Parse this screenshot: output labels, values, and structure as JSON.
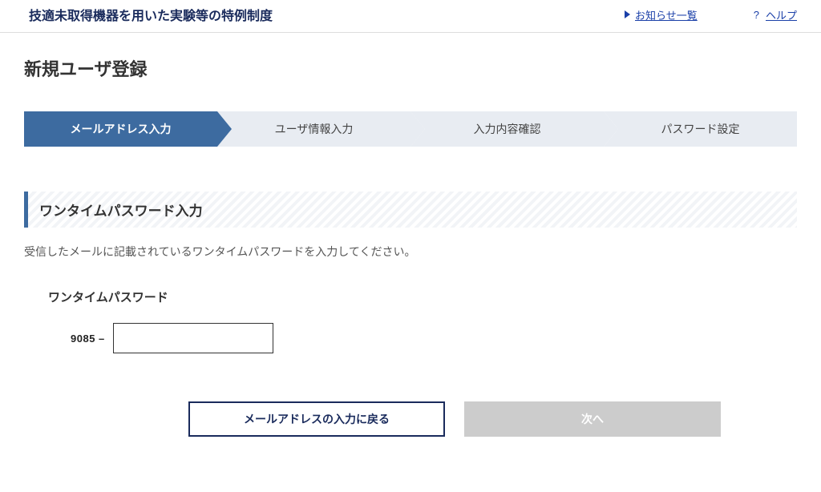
{
  "header": {
    "app_title": "技適未取得機器を用いた実験等の特例制度",
    "news_label": "お知らせ一覧",
    "help_label": "ヘルプ",
    "help_mark": "?"
  },
  "page": {
    "heading": "新規ユーザ登録"
  },
  "steps": {
    "s1": "メールアドレス入力",
    "s2": "ユーザ情報入力",
    "s3": "入力内容確認",
    "s4": "パスワード設定"
  },
  "section": {
    "title": "ワンタイムパスワード入力",
    "instruction": "受信したメールに記載されているワンタイムパスワードを入力してください。"
  },
  "otp": {
    "label": "ワンタイムパスワード",
    "prefix": "9085 –",
    "value": ""
  },
  "buttons": {
    "back": "メールアドレスの入力に戻る",
    "next": "次へ"
  }
}
